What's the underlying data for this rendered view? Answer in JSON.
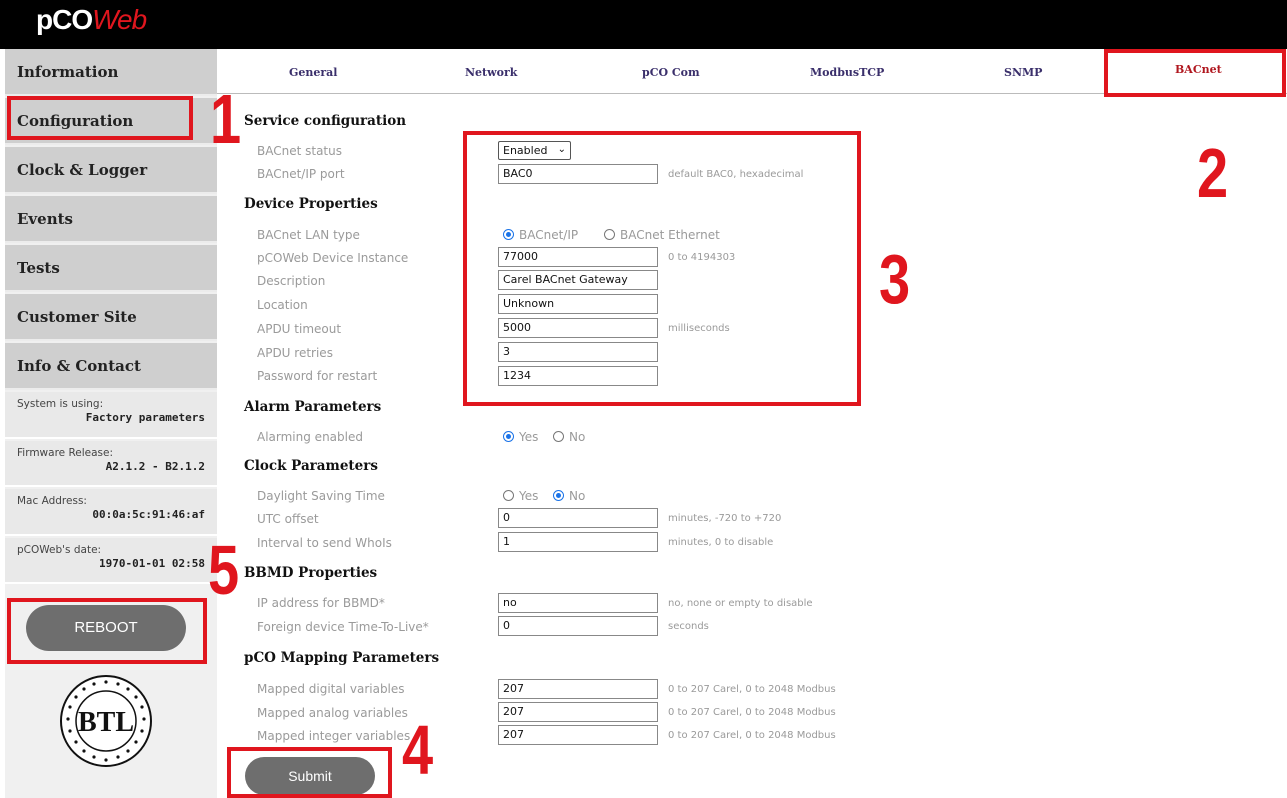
{
  "header": {
    "logo_part1": "pCO",
    "logo_part2": "Web"
  },
  "sidebar": {
    "items": [
      {
        "label": "Information"
      },
      {
        "label": "Configuration"
      },
      {
        "label": "Clock & Logger"
      },
      {
        "label": "Events"
      },
      {
        "label": "Tests"
      },
      {
        "label": "Customer Site"
      },
      {
        "label": "Info & Contact"
      }
    ],
    "info": [
      {
        "label": "System is using:",
        "value": "Factory parameters"
      },
      {
        "label": "Firmware Release:",
        "value": "A2.1.2 - B2.1.2"
      },
      {
        "label": "Mac Address:",
        "value": "00:0a:5c:91:46:af"
      },
      {
        "label": "pCOWeb's date:",
        "value": "1970-01-01 02:58"
      }
    ],
    "reboot_label": "REBOOT",
    "badge_letters": "BTL"
  },
  "tabs": [
    {
      "label": "General"
    },
    {
      "label": "Network"
    },
    {
      "label": "pCO Com"
    },
    {
      "label": "ModbusTCP"
    },
    {
      "label": "SNMP"
    },
    {
      "label": "BACnet",
      "active": true
    }
  ],
  "form": {
    "service": {
      "title": "Service configuration",
      "status_label": "BACnet status",
      "status_value": "Enabled",
      "port_label": "BACnet/IP port",
      "port_value": "BAC0",
      "port_note": "default BAC0, hexadecimal"
    },
    "device": {
      "title": "Device Properties",
      "lan_label": "BACnet LAN type",
      "lan_opt1": "BACnet/IP",
      "lan_opt2": "BACnet Ethernet",
      "lan_selected": "BACnet/IP",
      "instance_label": "pCOWeb Device Instance",
      "instance_value": "77000",
      "instance_note": "0 to 4194303",
      "desc_label": "Description",
      "desc_value": "Carel BACnet Gateway",
      "loc_label": "Location",
      "loc_value": "Unknown",
      "timeout_label": "APDU timeout",
      "timeout_value": "5000",
      "timeout_note": "milliseconds",
      "retries_label": "APDU retries",
      "retries_value": "3",
      "pwd_label": "Password for restart",
      "pwd_value": "1234"
    },
    "alarm": {
      "title": "Alarm Parameters",
      "enabled_label": "Alarming enabled",
      "yes": "Yes",
      "no": "No",
      "selected": "Yes"
    },
    "clock": {
      "title": "Clock Parameters",
      "dst_label": "Daylight Saving Time",
      "yes": "Yes",
      "no": "No",
      "selected": "No",
      "utc_label": "UTC offset",
      "utc_value": "0",
      "utc_note": "minutes, -720 to +720",
      "whois_label": "Interval to send WhoIs",
      "whois_value": "1",
      "whois_note": "minutes, 0 to disable"
    },
    "bbmd": {
      "title": "BBMD Properties",
      "ip_label": "IP address for BBMD*",
      "ip_value": "no",
      "ip_note": "no, none or empty to disable",
      "ttl_label": "Foreign device Time-To-Live*",
      "ttl_value": "0",
      "ttl_note": "seconds"
    },
    "mapping": {
      "title": "pCO Mapping Parameters",
      "dig_label": "Mapped digital variables",
      "dig_value": "207",
      "dig_note": "0 to 207 Carel, 0 to 2048 Modbus",
      "ana_label": "Mapped analog variables",
      "ana_value": "207",
      "ana_note": "0 to 207 Carel, 0 to 2048 Modbus",
      "int_label": "Mapped integer variables",
      "int_value": "207",
      "int_note": "0 to 207 Carel, 0 to 2048 Modbus"
    },
    "submit_label": "Submit"
  },
  "annotations": [
    "1",
    "2",
    "3",
    "4",
    "5"
  ],
  "colors": {
    "annotation": "#e0161e",
    "active_tab": "#b0171f",
    "tab": "#3a2f6b",
    "button": "#6e6e6e"
  }
}
